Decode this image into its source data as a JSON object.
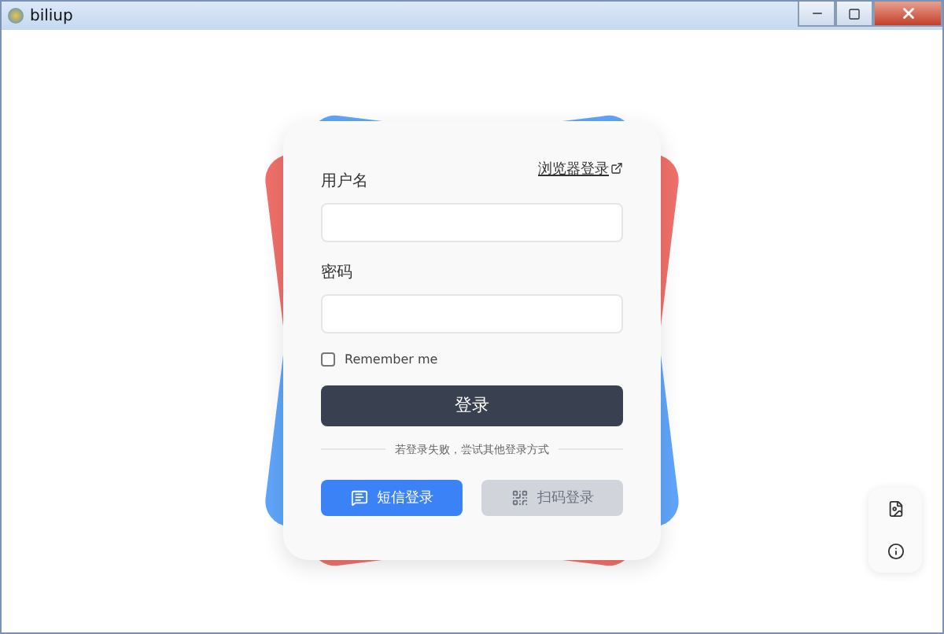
{
  "window": {
    "title": "biliup"
  },
  "login": {
    "browser_link": "浏览器登录",
    "fields": [
      {
        "label": "用户名"
      },
      {
        "label": "密码"
      }
    ],
    "remember": {
      "label": "Remember me",
      "checked": false
    },
    "submit": "登录",
    "divider": "若登录失败，尝试其他登录方式",
    "alternatives": [
      {
        "kind": "sms",
        "label": "短信登录",
        "disabled": false
      },
      {
        "kind": "qr",
        "label": "扫码登录",
        "disabled": true
      }
    ]
  },
  "side_tools": [
    {
      "kind": "log"
    },
    {
      "kind": "info"
    }
  ]
}
